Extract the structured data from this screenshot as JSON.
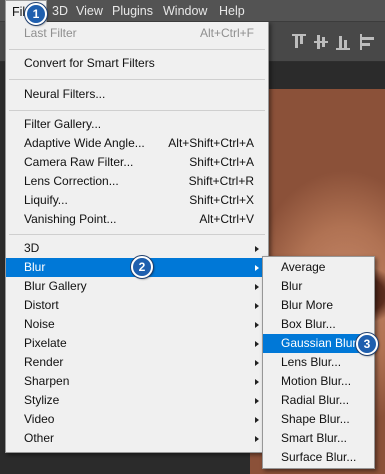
{
  "menubar": {
    "items": [
      "Filter",
      "3D",
      "View",
      "Plugins",
      "Window",
      "Help"
    ]
  },
  "filter_menu": {
    "last_filter": {
      "label": "Last Filter",
      "shortcut": "Alt+Ctrl+F",
      "disabled": true
    },
    "convert_smart": "Convert for Smart Filters",
    "neural": "Neural Filters...",
    "items": [
      {
        "label": "Filter Gallery...",
        "shortcut": ""
      },
      {
        "label": "Adaptive Wide Angle...",
        "shortcut": "Alt+Shift+Ctrl+A"
      },
      {
        "label": "Camera Raw Filter...",
        "shortcut": "Shift+Ctrl+A"
      },
      {
        "label": "Lens Correction...",
        "shortcut": "Shift+Ctrl+R"
      },
      {
        "label": "Liquify...",
        "shortcut": "Shift+Ctrl+X"
      },
      {
        "label": "Vanishing Point...",
        "shortcut": "Alt+Ctrl+V"
      }
    ],
    "submenus": [
      "3D",
      "Blur",
      "Blur Gallery",
      "Distort",
      "Noise",
      "Pixelate",
      "Render",
      "Sharpen",
      "Stylize",
      "Video",
      "Other"
    ],
    "highlighted": "Blur"
  },
  "blur_menu": {
    "items": [
      "Average",
      "Blur",
      "Blur More",
      "Box Blur...",
      "Gaussian Blur...",
      "Lens Blur...",
      "Motion Blur...",
      "Radial Blur...",
      "Shape Blur...",
      "Smart Blur...",
      "Surface Blur..."
    ],
    "highlighted": "Gaussian Blur..."
  },
  "steps": [
    "1",
    "2",
    "3"
  ],
  "colors": {
    "highlight": "#0078d7",
    "menu_bg": "#f0f0f0",
    "step_badge": "#1f5fae"
  }
}
